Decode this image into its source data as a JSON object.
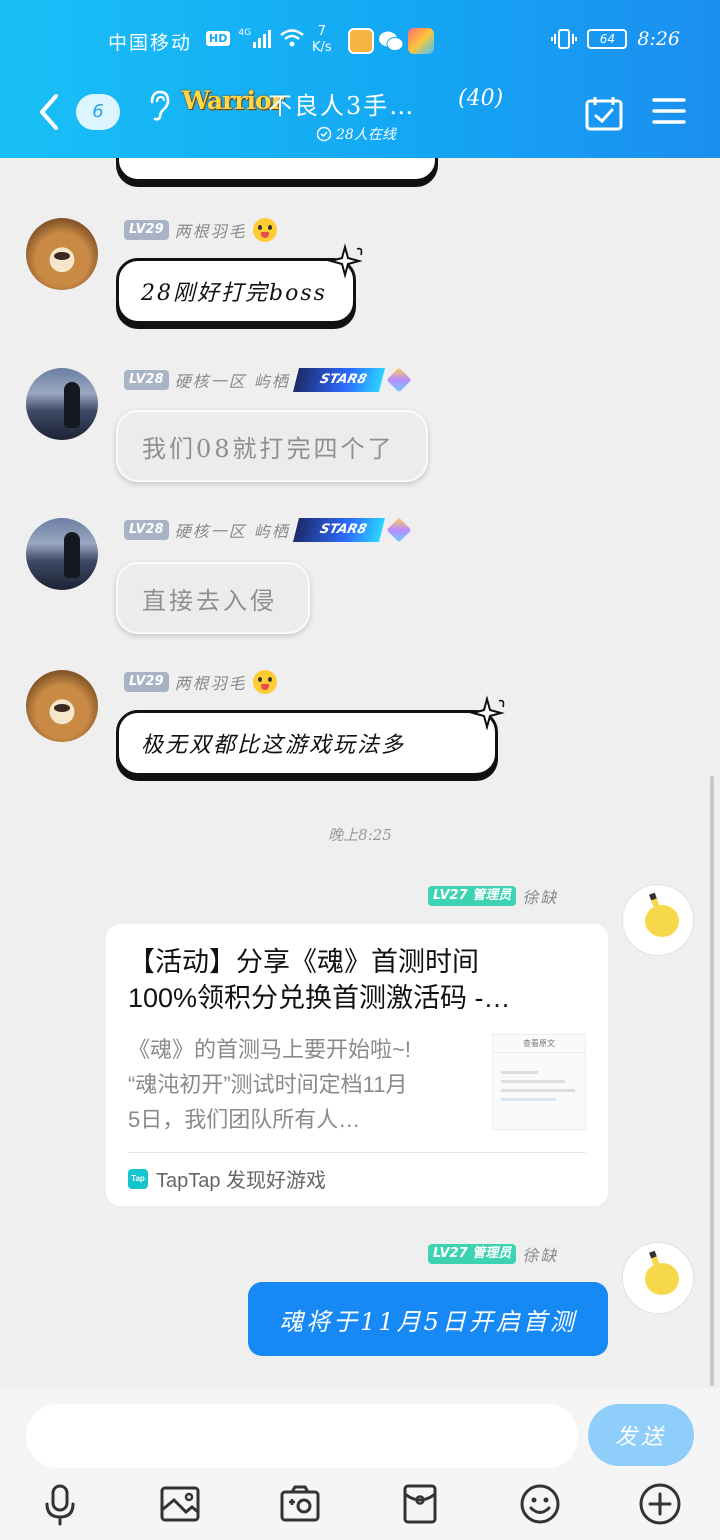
{
  "status_bar": {
    "carrier": "中国移动",
    "hd": "HD",
    "signal": "4G",
    "net_speed_value": "7",
    "net_speed_unit": "K/s",
    "battery": "64",
    "time": "8:26"
  },
  "header": {
    "unread_count": "6",
    "logo_text": "Warrior",
    "group_name": "不良人3手…",
    "member_count": "(40)",
    "online": "28人在线"
  },
  "messages": [
    {
      "level": "LV29",
      "nick": "两根羽毛",
      "text": "28刚好打完boss"
    },
    {
      "level": "LV28",
      "nick": "硬核一区 屿栖",
      "badge": "STAR8",
      "text": "我们08就打完四个了"
    },
    {
      "level": "LV28",
      "nick": "硬核一区 屿栖",
      "badge": "STAR8",
      "text": "直接去入侵"
    },
    {
      "level": "LV29",
      "nick": "两根羽毛",
      "text": "极无双都比这游戏玩法多"
    }
  ],
  "time_divider": "晚上8:25",
  "admin_messages": [
    {
      "level": "LV27",
      "role": "管理员",
      "nick": "徐缺"
    },
    {
      "level": "LV27",
      "role": "管理员",
      "nick": "徐缺"
    }
  ],
  "share_card": {
    "title_line1": "【活动】分享《魂》首测时间",
    "title_line2": "100%领积分兑换首测激活码 -…",
    "desc_line1": "《魂》的首测马上要开始啦~!",
    "desc_line2": "“魂沌初开”测试时间定档11月",
    "desc_line3": "5日，我们团队所有人…",
    "thumb_header": "查看原文",
    "source_icon": "Tap",
    "source": "TapTap 发现好游戏"
  },
  "final_message": "魂将于11月5日开启首测",
  "input": {
    "placeholder": "",
    "send_label": "发送"
  },
  "toolbar": [
    "microphone-icon",
    "image-icon",
    "camera-icon",
    "red-packet-icon",
    "emoji-icon",
    "plus-icon"
  ],
  "colors": {
    "header_start": "#19c0f6",
    "header_end": "#1b8ef0",
    "send_bubble": "#1789f5",
    "admin_badge": "#3dd3b2",
    "send_button": "#8fcdfa"
  }
}
